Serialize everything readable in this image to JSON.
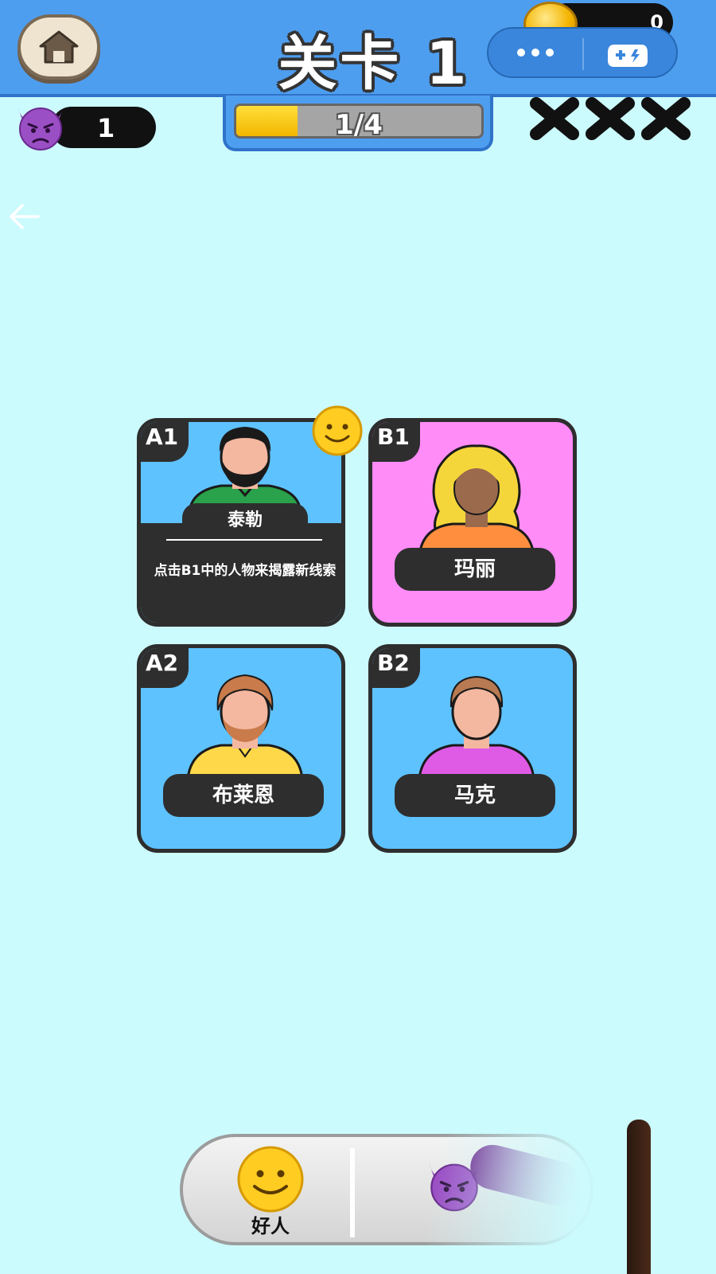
{
  "header": {
    "title": "关卡 1",
    "coins": "0",
    "coin_add": "+"
  },
  "status": {
    "villain_count": "1",
    "progress_text": "1/4",
    "progress_fraction": 0.25,
    "strikes": [
      "✖",
      "✖",
      "✖"
    ]
  },
  "cards": [
    {
      "id": "A1",
      "name": "泰勒",
      "hint": "点击B1中的人物来揭露新线索",
      "bg": "#5ec2ff",
      "shirt": "#2aa14b",
      "skin": "#f4b7a0",
      "hair": "#1a1a1a",
      "badge": "smiley"
    },
    {
      "id": "B1",
      "name": "玛丽",
      "bg": "#ff8cf7",
      "shirt": "#ff8f3f",
      "skin": "#9b6a4d",
      "hair": "#f5d63a"
    },
    {
      "id": "A2",
      "name": "布莱恩",
      "bg": "#5ec2ff",
      "shirt": "#ffd84a",
      "skin": "#f4b7a0",
      "hair": "#c97b4b"
    },
    {
      "id": "B2",
      "name": "马克",
      "bg": "#5ec2ff",
      "shirt": "#e05be5",
      "skin": "#f4b7a0",
      "hair": "#b77a52"
    }
  ],
  "dock": {
    "good_label": "好人"
  },
  "colors": {
    "background": "#ccfbfe",
    "topbar": "#4e9ef0",
    "card_dark": "#2e2e2e"
  }
}
